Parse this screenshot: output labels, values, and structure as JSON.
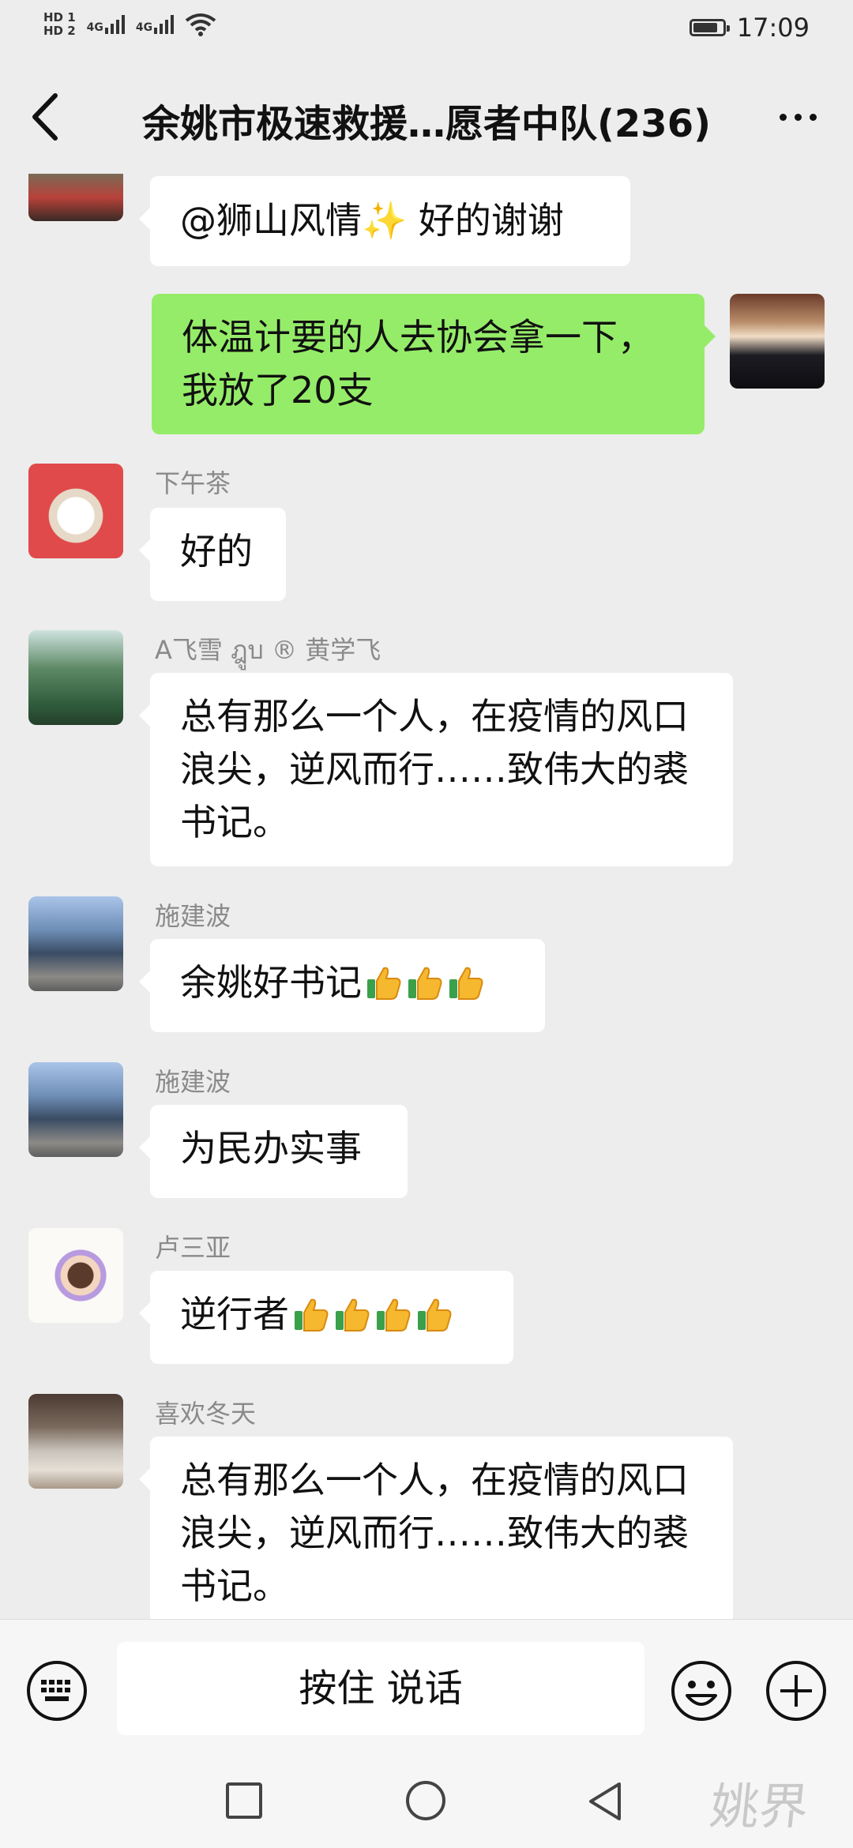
{
  "status_bar": {
    "sim1": "HD 1",
    "sim2": "HD 2",
    "net1": "4G",
    "net2": "4G",
    "time": "17:09",
    "battery_level": 0.9
  },
  "header": {
    "title": "余姚市极速救援…愿者中队(236)"
  },
  "messages": [
    {
      "side": "left",
      "sender": "",
      "text": "@狮山风情✨ 好的谢谢"
    },
    {
      "side": "right",
      "sender": "",
      "text": "体温计要的人去协会拿一下，我放了20支"
    },
    {
      "side": "left",
      "sender": "下午茶",
      "text": "好的"
    },
    {
      "side": "left",
      "sender": "A飞雪 ฎูบ ® 黄学飞",
      "text": "总有那么一个人，在疫情的风口浪尖，逆风而行……致伟大的裘书记。"
    },
    {
      "side": "left",
      "sender": "施建波",
      "text": "余姚好书记",
      "thumbs": 3
    },
    {
      "side": "left",
      "sender": "施建波",
      "text": "为民办实事"
    },
    {
      "side": "left",
      "sender": "卢三亚",
      "text": "逆行者",
      "thumbs": 4
    },
    {
      "side": "left",
      "sender": "喜欢冬天",
      "text": "总有那么一个人，在疫情的风口浪尖，逆风而行……致伟大的裘书记。"
    }
  ],
  "input_bar": {
    "hold_to_talk": "按住 说话"
  },
  "watermark": "姚界",
  "colors": {
    "background": "#ededed",
    "own_bubble": "#95ec69",
    "other_bubble": "#ffffff"
  }
}
